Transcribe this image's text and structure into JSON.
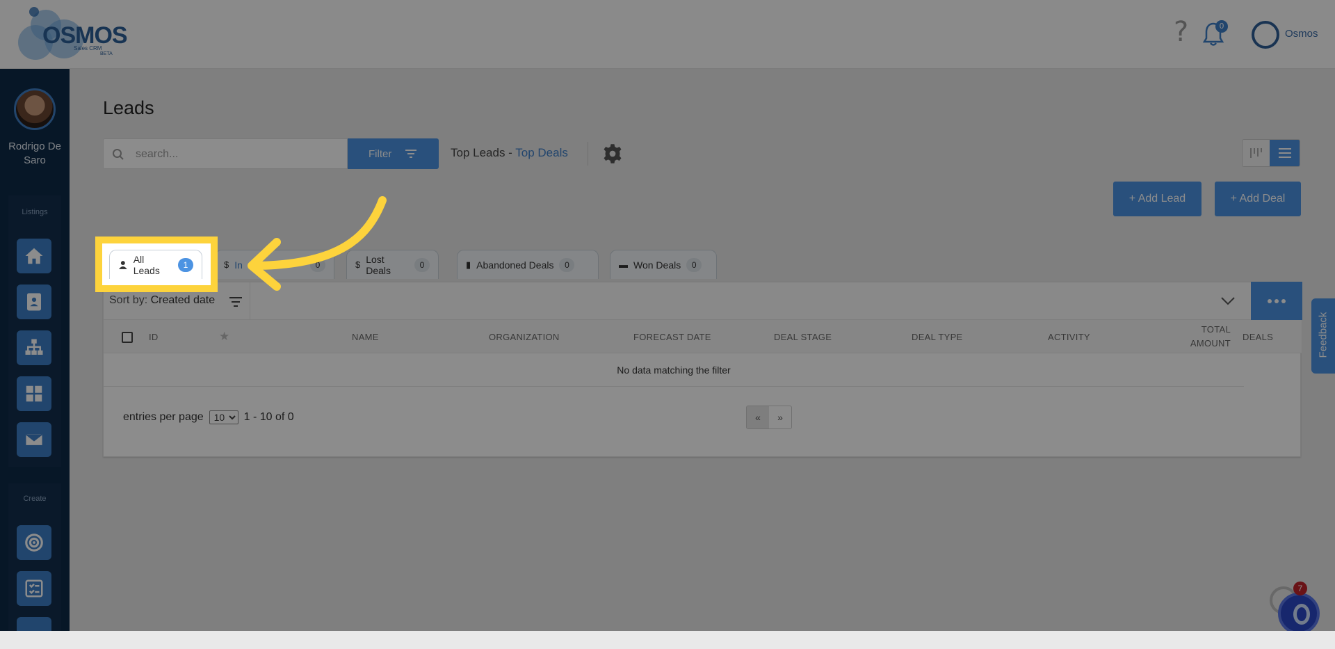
{
  "header": {
    "logo_word": "OSMOS",
    "logo_sub": "Sales CRM",
    "logo_beta": "BETA",
    "help_glyph": "?",
    "notifications_count": "0",
    "user_name": "Osmos"
  },
  "sidebar": {
    "profile_name": "Rodrigo De Saro",
    "section_listings": "Listings",
    "section_create": "Create",
    "listing_icons": [
      "home-icon",
      "contact-card-icon",
      "org-chart-icon",
      "dashboard-icon",
      "mail-icon"
    ],
    "create_icons": [
      "target-icon",
      "checklist-icon"
    ]
  },
  "page": {
    "title": "Leads",
    "search_placeholder": "search...",
    "filter_label": "Filter",
    "top_leads_text": "Top Leads - ",
    "top_deals_link": "Top Deals",
    "add_lead_label": "+ Add Lead",
    "add_deal_label": "+ Add Deal"
  },
  "tabs": [
    {
      "label": "All Leads",
      "count": "1",
      "icon": "person-icon"
    },
    {
      "label": "In",
      "count": "0",
      "icon": "dollar-icon"
    },
    {
      "label": "Lost Deals",
      "count": "0",
      "icon": "dollar-icon"
    },
    {
      "label": "Abandoned Deals",
      "count": "0",
      "icon": "document-icon"
    },
    {
      "label": "Won Deals",
      "count": "0",
      "icon": "credit-card-icon"
    }
  ],
  "table": {
    "sort_prefix": "Sort by: ",
    "sort_value": "Created date",
    "columns": [
      "ID",
      "NAME",
      "ORGANIZATION",
      "FORECAST DATE",
      "DEAL STAGE",
      "DEAL TYPE",
      "ACTIVITY",
      "TOTAL AMOUNT",
      "DEALS"
    ],
    "empty_message": "No data matching the filter",
    "entries_label": "entries per page",
    "per_page": "10",
    "range_text": "1 - 10 of 0",
    "prev": "«",
    "next": "»"
  },
  "feedback_label": "Feedback",
  "widget_badge": "7",
  "colors": {
    "accent": "#4c93e2",
    "sidebar": "#0e2a47",
    "highlight": "#fdd33c"
  }
}
